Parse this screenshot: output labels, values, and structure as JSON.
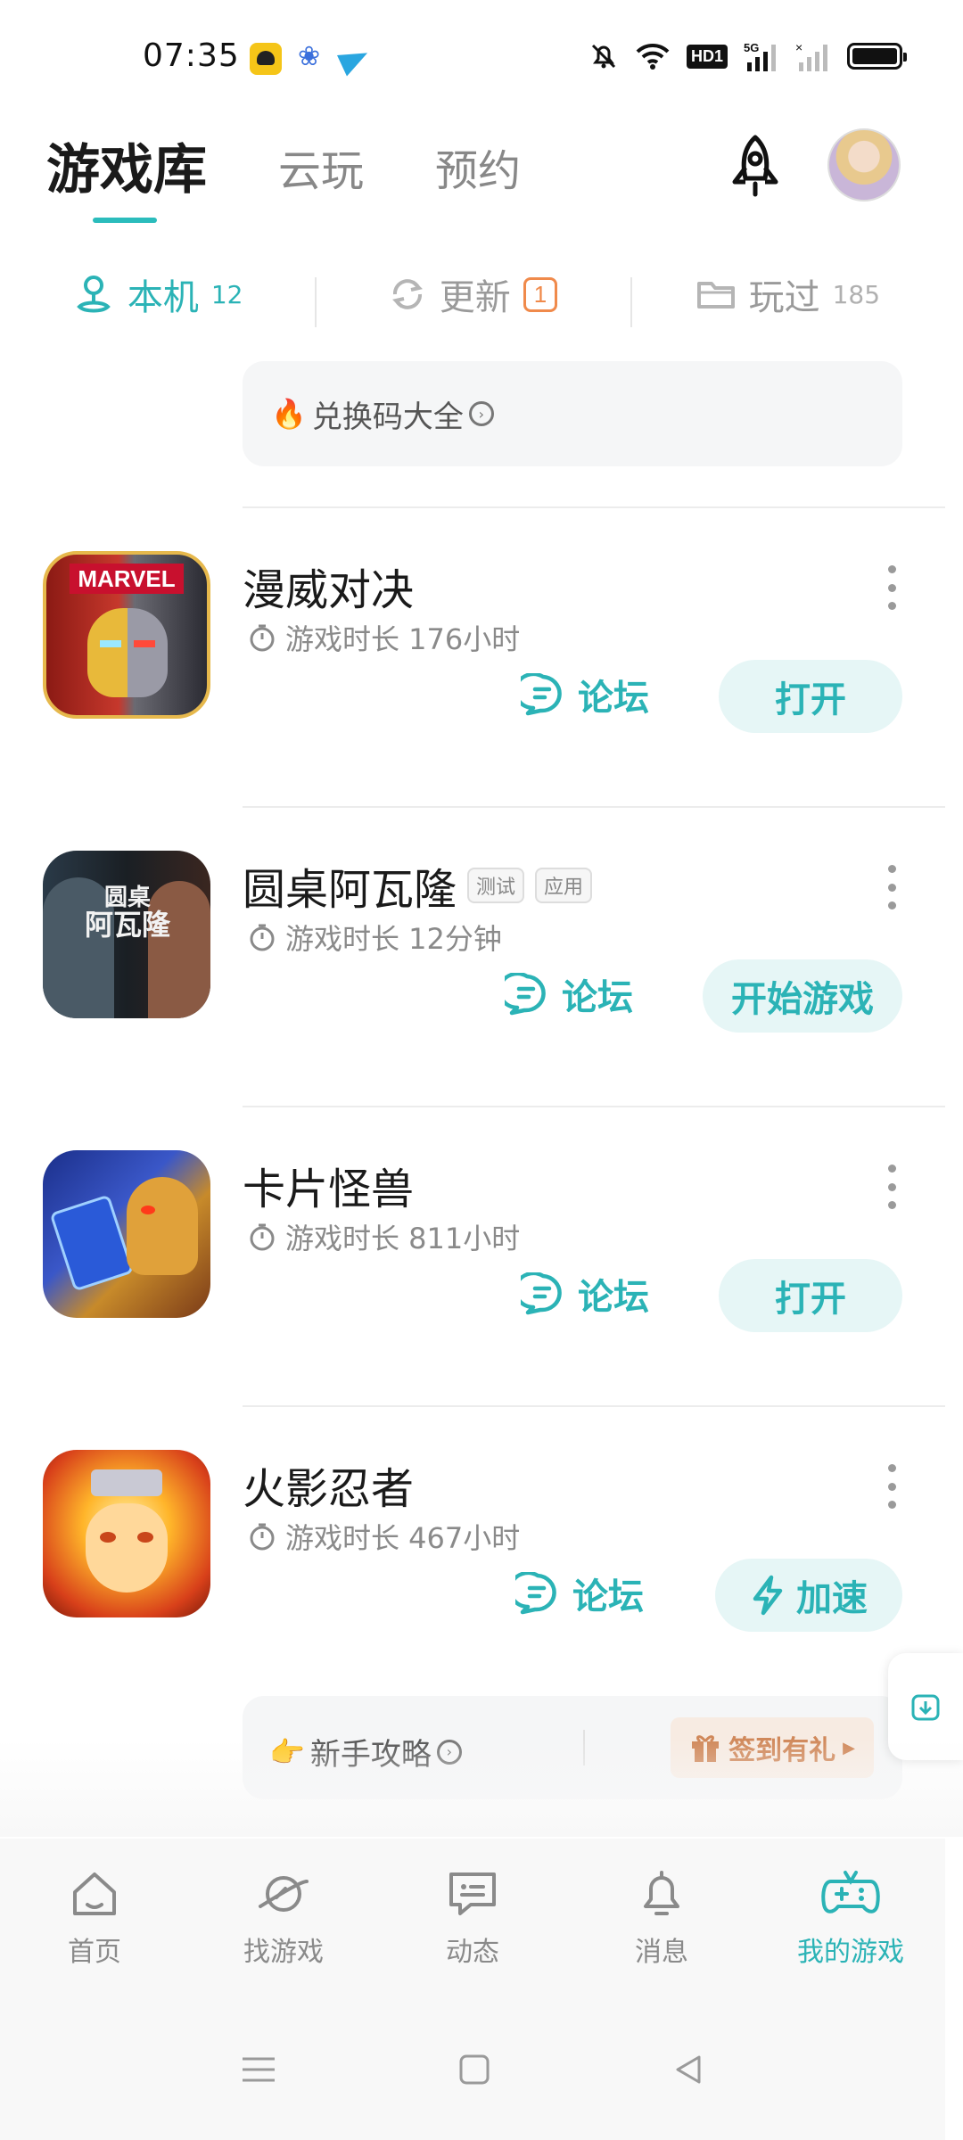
{
  "status_bar": {
    "time": "07:35",
    "hd": "HD1",
    "network": "5G"
  },
  "header": {
    "tabs": [
      {
        "label": "游戏库",
        "active": true
      },
      {
        "label": "云玩",
        "active": false
      },
      {
        "label": "预约",
        "active": false
      }
    ]
  },
  "sub_tabs": [
    {
      "label": "本机",
      "count": "12",
      "active": true,
      "icon": "location-pin-icon"
    },
    {
      "label": "更新",
      "badge": "1",
      "active": false,
      "icon": "refresh-icon"
    },
    {
      "label": "玩过",
      "count": "185",
      "active": false,
      "icon": "folder-icon"
    }
  ],
  "redeem_banner": {
    "emoji": "🔥",
    "text": "兑换码大全"
  },
  "games": [
    {
      "name": "漫威对决",
      "playtime": "游戏时长 176小时",
      "forum_label": "论坛",
      "action_label": "打开",
      "tags": []
    },
    {
      "name": "圆桌阿瓦隆",
      "playtime": "游戏时长 12分钟",
      "forum_label": "论坛",
      "action_label": "开始游戏",
      "tags": [
        "测试",
        "应用"
      ],
      "icon_text": "圆桌阿瓦隆"
    },
    {
      "name": "卡片怪兽",
      "playtime": "游戏时长 811小时",
      "forum_label": "论坛",
      "action_label": "打开",
      "tags": []
    },
    {
      "name": "火影忍者",
      "playtime": "游戏时长 467小时",
      "forum_label": "论坛",
      "action_label": "加速",
      "tags": []
    }
  ],
  "icon_text": {
    "marvel": "MARVEL",
    "avalon_1": "圆桌",
    "avalon_2": "阿瓦隆"
  },
  "guide_banner": {
    "emoji": "👉",
    "text": "新手攻略",
    "signin_label": "签到有礼"
  },
  "bottom_nav": [
    {
      "label": "首页",
      "icon": "home-icon",
      "active": false
    },
    {
      "label": "找游戏",
      "icon": "planet-icon",
      "active": false
    },
    {
      "label": "动态",
      "icon": "chat-icon",
      "active": false
    },
    {
      "label": "消息",
      "icon": "bell-icon",
      "active": false
    },
    {
      "label": "我的游戏",
      "icon": "gamepad-icon",
      "active": true
    }
  ],
  "colors": {
    "accent": "#2bb3b6",
    "badge": "#f08a4b",
    "signin": "#d0885a"
  }
}
